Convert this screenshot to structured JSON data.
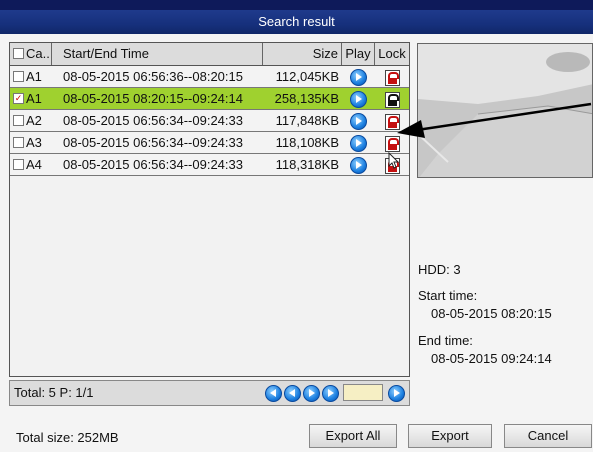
{
  "window": {
    "title": "Search result"
  },
  "table": {
    "headers": {
      "camera": "Ca...",
      "time": "Start/End Time",
      "size": "Size",
      "play": "Play",
      "lock": "Lock"
    },
    "rows": [
      {
        "camera": "A1",
        "time": "08-05-2015 06:56:36--08:20:15",
        "size": "112,045KB",
        "checked": false,
        "locked": false,
        "selected": false
      },
      {
        "camera": "A1",
        "time": "08-05-2015 08:20:15--09:24:14",
        "size": "258,135KB",
        "checked": true,
        "locked": true,
        "selected": true
      },
      {
        "camera": "A2",
        "time": "08-05-2015 06:56:34--09:24:33",
        "size": "117,848KB",
        "checked": false,
        "locked": false,
        "selected": false
      },
      {
        "camera": "A3",
        "time": "08-05-2015 06:56:34--09:24:33",
        "size": "118,108KB",
        "checked": false,
        "locked": false,
        "selected": false
      },
      {
        "camera": "A4",
        "time": "08-05-2015 06:56:34--09:24:33",
        "size": "118,318KB",
        "checked": false,
        "locked": false,
        "selected": false
      }
    ],
    "check_mark": "✓"
  },
  "pagination": {
    "total_label": "Total: 5  P: 1/1",
    "page_input_value": ""
  },
  "info": {
    "hdd": "HDD: 3",
    "start_label": "Start time:",
    "start_value": "08-05-2015 08:20:15",
    "end_label": "End time:",
    "end_value": "08-05-2015 09:24:14"
  },
  "footer": {
    "total_size": "Total size: 252MB",
    "export_all": "Export All",
    "export": "Export",
    "cancel": "Cancel"
  },
  "icons": {
    "play": "play-icon",
    "lock": "lock-icon",
    "unlock": "unlock-icon"
  },
  "colors": {
    "title_bar": "#16307c",
    "selected_row": "#9fd12f",
    "lock_red": "#c41010"
  }
}
